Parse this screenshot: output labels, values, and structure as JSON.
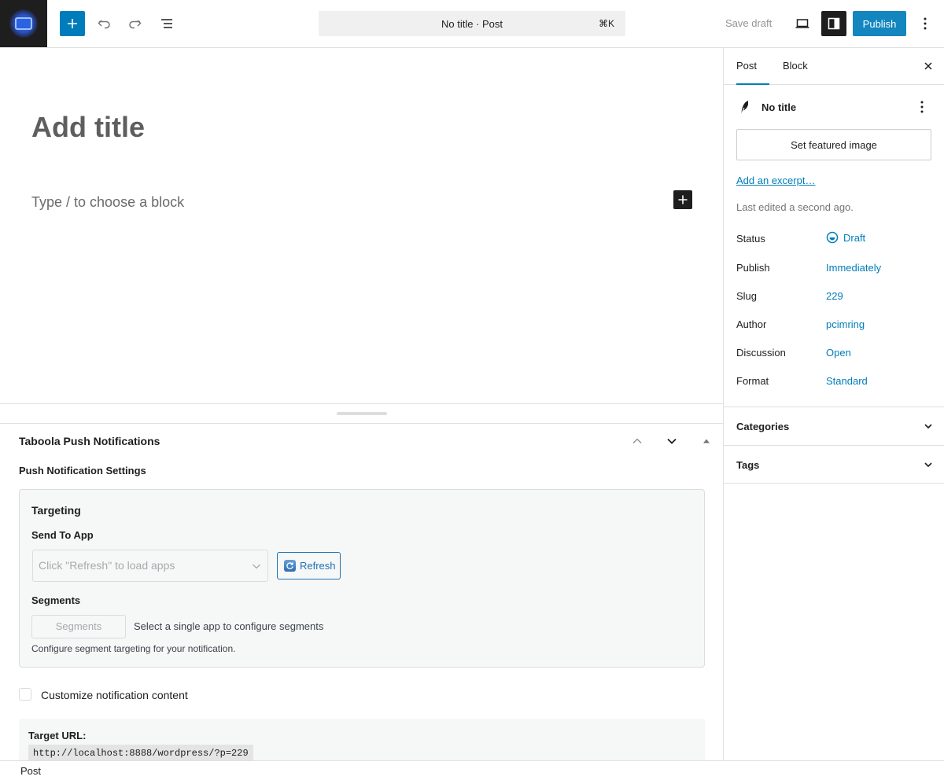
{
  "header": {
    "command_bar": "No title · Post",
    "shortcut": "⌘K",
    "save_draft": "Save draft",
    "publish": "Publish"
  },
  "editor": {
    "title_placeholder": "Add title",
    "block_placeholder": "Type / to choose a block"
  },
  "metabox": {
    "title": "Taboola Push Notifications",
    "subtitle": "Push Notification Settings",
    "targeting": {
      "heading": "Targeting",
      "send_to_app_label": "Send To App",
      "app_select_placeholder": "Click \"Refresh\" to load apps",
      "refresh_label": "Refresh",
      "segments_label": "Segments",
      "segments_button": "Segments",
      "segments_hint": "Select a single app to configure segments",
      "segments_desc": "Configure segment targeting for your notification."
    },
    "customize_label": "Customize notification content",
    "target_url_label": "Target URL:",
    "target_url": "http://localhost:8888/wordpress/?p=229"
  },
  "footer": {
    "breadcrumb": "Post"
  },
  "sidebar": {
    "tabs": [
      "Post",
      "Block"
    ],
    "post_title": "No title",
    "featured_image": "Set featured image",
    "excerpt_link": "Add an excerpt…",
    "last_edited": "Last edited a second ago.",
    "meta": [
      {
        "label": "Status",
        "value": "Draft"
      },
      {
        "label": "Publish",
        "value": "Immediately"
      },
      {
        "label": "Slug",
        "value": "229"
      },
      {
        "label": "Author",
        "value": "pcimring"
      },
      {
        "label": "Discussion",
        "value": "Open"
      },
      {
        "label": "Format",
        "value": "Standard"
      }
    ],
    "panels": [
      "Categories",
      "Tags"
    ]
  },
  "colors": {
    "accent": "#007cba",
    "dark": "#1e1e1e",
    "border": "#e0e0e0"
  }
}
